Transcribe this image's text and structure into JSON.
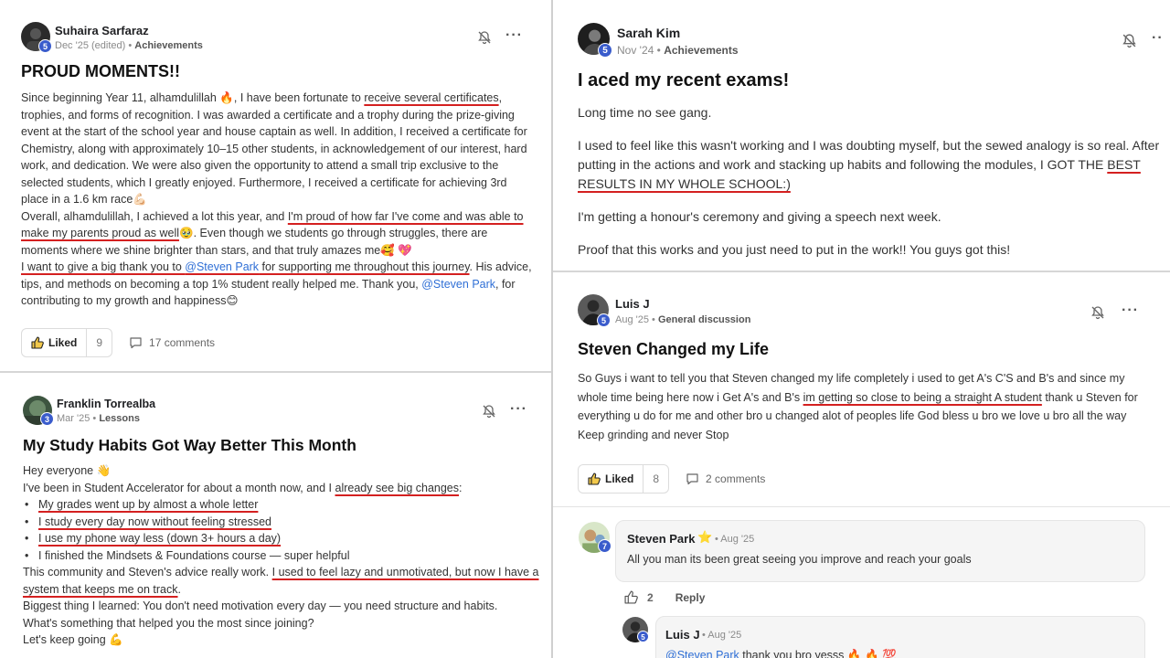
{
  "post1": {
    "author": "Suhaira Sarfaraz",
    "level": "5",
    "date": "Dec '25 (edited)",
    "sep": " • ",
    "category": "Achievements",
    "title": "PROUD MOMENTS!!",
    "t1": "Since beginning Year 11, alhamdulillah ",
    "e1": "🔥",
    "t2": ", I have been fortunate to ",
    "u1": "receive several certificates",
    "t3": ", trophies, and forms of recognition. I was awarded a certificate and a trophy during the prize-giving event at the start of the school year and house captain as well. In addition, I received a certificate for Chemistry, along with approximately 10–15 other students, in acknowledgement of our interest, hard work, and dedication. We were also given the opportunity to attend a small trip exclusive to the selected students, which I greatly enjoyed. Furthermore, I received a certificate for achieving 3rd place in a 1.6 km race",
    "e2": "💪🏻",
    "t4": "Overall, alhamdulillah, I achieved a lot this year, and ",
    "u2": "I'm proud of how far I've come and was able to make my parents proud as well",
    "e3": "🥹",
    "t5": ". Even though we students go through struggles, there are moments where we shine brighter than stars, and that truly amazes me",
    "e4": "🥰 💖",
    "u3a": "I want to give a big thank you to ",
    "mention1": "@Steven Park",
    "u3b": " for supporting me throughout this journey",
    "t6": ". His advice, tips, and methods on becoming a top 1% student really helped me. Thank you, ",
    "mention2": "@Steven Park",
    "t7": ", for contributing to my growth and happiness",
    "e5": "😊",
    "liked": "Liked",
    "likes": "9",
    "comments": "17 comments"
  },
  "post2": {
    "author": "Franklin Torrealba",
    "level": "3",
    "date": "Mar '25",
    "sep": " • ",
    "category": "Lessons",
    "title": "My Study Habits Got Way Better This Month",
    "l1": "Hey everyone ",
    "e1": "👋",
    "l2a": "I've been in Student Accelerator for about a month now, and I ",
    "l2u": "already see big changes",
    "l2b": ":",
    "bullets": [
      "My grades went up by almost a whole letter",
      "I study every day now without feeling stressed",
      "I use my phone way less (down 3+ hours a day)",
      "I finished the Mindsets & Foundations course — super helpful"
    ],
    "l3a": "This community and Steven's advice really work. ",
    "l3u": "I used to feel lazy and unmotivated, but now I have a system that keeps me on track",
    "l3b": ".",
    "l4": "Biggest thing I learned: You don't need motivation every day — you need structure and habits.",
    "l5": "What's something that helped you the most since joining?",
    "l6": "Let's keep going ",
    "e2": "💪"
  },
  "post3": {
    "author": "Sarah Kim",
    "level": "5",
    "date": "Nov '24",
    "sep": " • ",
    "category": "Achievements",
    "title": "I aced my recent exams!",
    "p1": "Long time no see gang.",
    "p2a": "I used to feel like this wasn't working and I was doubting myself, but the sewed analogy is so real. After putting in the actions and work and stacking up habits and following the modules, I GOT THE ",
    "p2u": "BEST RESULTS IN MY WHOLE SCHOOL:)",
    "p3": "I'm getting a honour's ceremony and giving a speech next week.",
    "p4": "Proof that this works and you just need to put in the work!! You guys got this!"
  },
  "post4": {
    "author": "Luis J",
    "level": "5",
    "date": "Aug '25",
    "sep": " • ",
    "category": "General discussion",
    "title": "Steven Changed my Life",
    "b1": "So Guys i want to tell you that Steven changed my life completely i used to get A's C'S and B's and since my whole time being here now i Get A's and B's ",
    "bu": "im getting so close to being a straight A student",
    "b2": " thank u Steven for everything u do for me and other bro u changed alot of peoples life God bless u bro we love u bro all the way Keep grinding and never Stop",
    "liked": "Liked",
    "likes": "8",
    "comments": "2 comments",
    "comment1": {
      "author": "Steven Park",
      "level": "7",
      "star": "⭐",
      "date": " • Aug '25",
      "text": "All you man its been great seeing you improve and reach your goals",
      "likes": "2",
      "reply": "Reply"
    },
    "comment2": {
      "author": "Luis J",
      "level": "5",
      "date": " • Aug '25",
      "mention": "@Steven Park",
      "text": " thank you bro yesss ",
      "emoji": "🔥 🔥 💯"
    }
  },
  "colors": {
    "mention": "#2f6fd6",
    "underline": "#d42020",
    "level_badge": "#3a5ccc"
  }
}
